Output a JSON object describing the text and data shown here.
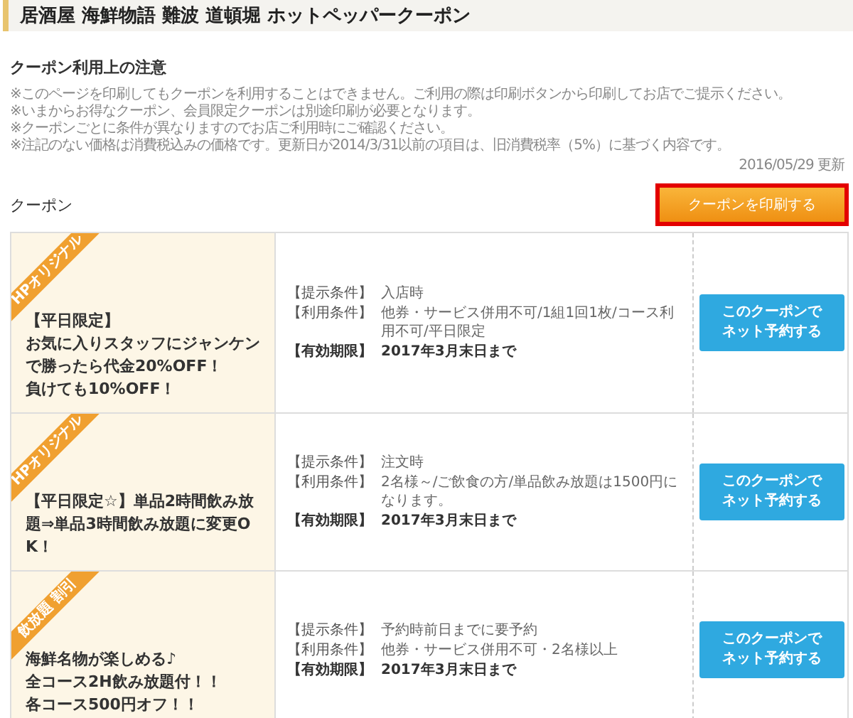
{
  "header": {
    "title": "居酒屋 海鮮物語 難波 道頓堀 ホットペッパークーポン"
  },
  "notice": {
    "heading": "クーポン利用上の注意",
    "lines": [
      "※このページを印刷してもクーポンを利用することはできません。ご利用の際は印刷ボタンから印刷してお店でご提示ください。",
      "※いまからお得なクーポン、会員限定クーポンは別途印刷が必要となります。",
      "※クーポンごとに条件が異なりますのでお店ご利用時にご確認ください。",
      "※注記のない価格は消費税込みの価格です。更新日が2014/3/31以前の項目は、旧消費税率（5%）に基づく内容です。"
    ],
    "updated": "2016/05/29 更新"
  },
  "coupons_section": {
    "title": "クーポン",
    "print_button": "クーポンを印刷する"
  },
  "coupons": [
    {
      "ribbon": "HPオリジナル",
      "title_lines": [
        "【平日限定】",
        "お気に入りスタッフにジャンケン",
        "で勝ったら代金20%OFF！",
        "負けても10%OFF！"
      ],
      "conditions": [
        {
          "label": "【提示条件】",
          "value": "入店時"
        },
        {
          "label": "【利用条件】",
          "value": "他券・サービス併用不可/1組1回1枚/コース利用不可/平日限定"
        },
        {
          "label": "【有効期限】",
          "value": "2017年3月末日まで"
        }
      ],
      "button": [
        "このクーポンで",
        "ネット予約する"
      ]
    },
    {
      "ribbon": "HPオリジナル",
      "title_lines": [
        "【平日限定☆】単品2時間飲み放",
        "題⇒単品3時間飲み放題に変更O",
        "K！"
      ],
      "conditions": [
        {
          "label": "【提示条件】",
          "value": "注文時"
        },
        {
          "label": "【利用条件】",
          "value": "2名様～/ご飲食の方/単品飲み放題は1500円になります。"
        },
        {
          "label": "【有効期限】",
          "value": "2017年3月末日まで"
        }
      ],
      "button": [
        "このクーポンで",
        "ネット予約する"
      ]
    },
    {
      "ribbon": "飲放題 割引",
      "title_lines": [
        "海鮮名物が楽しめる♪",
        "全コース2H飲み放題付！！",
        "各コース500円オフ！！"
      ],
      "conditions": [
        {
          "label": "【提示条件】",
          "value": "予約時前日までに要予約"
        },
        {
          "label": "【利用条件】",
          "value": "他券・サービス併用不可・2名様以上"
        },
        {
          "label": "【有効期限】",
          "value": "2017年3月末日まで"
        }
      ],
      "button": [
        "このクーポンで",
        "ネット予約する"
      ]
    }
  ]
}
